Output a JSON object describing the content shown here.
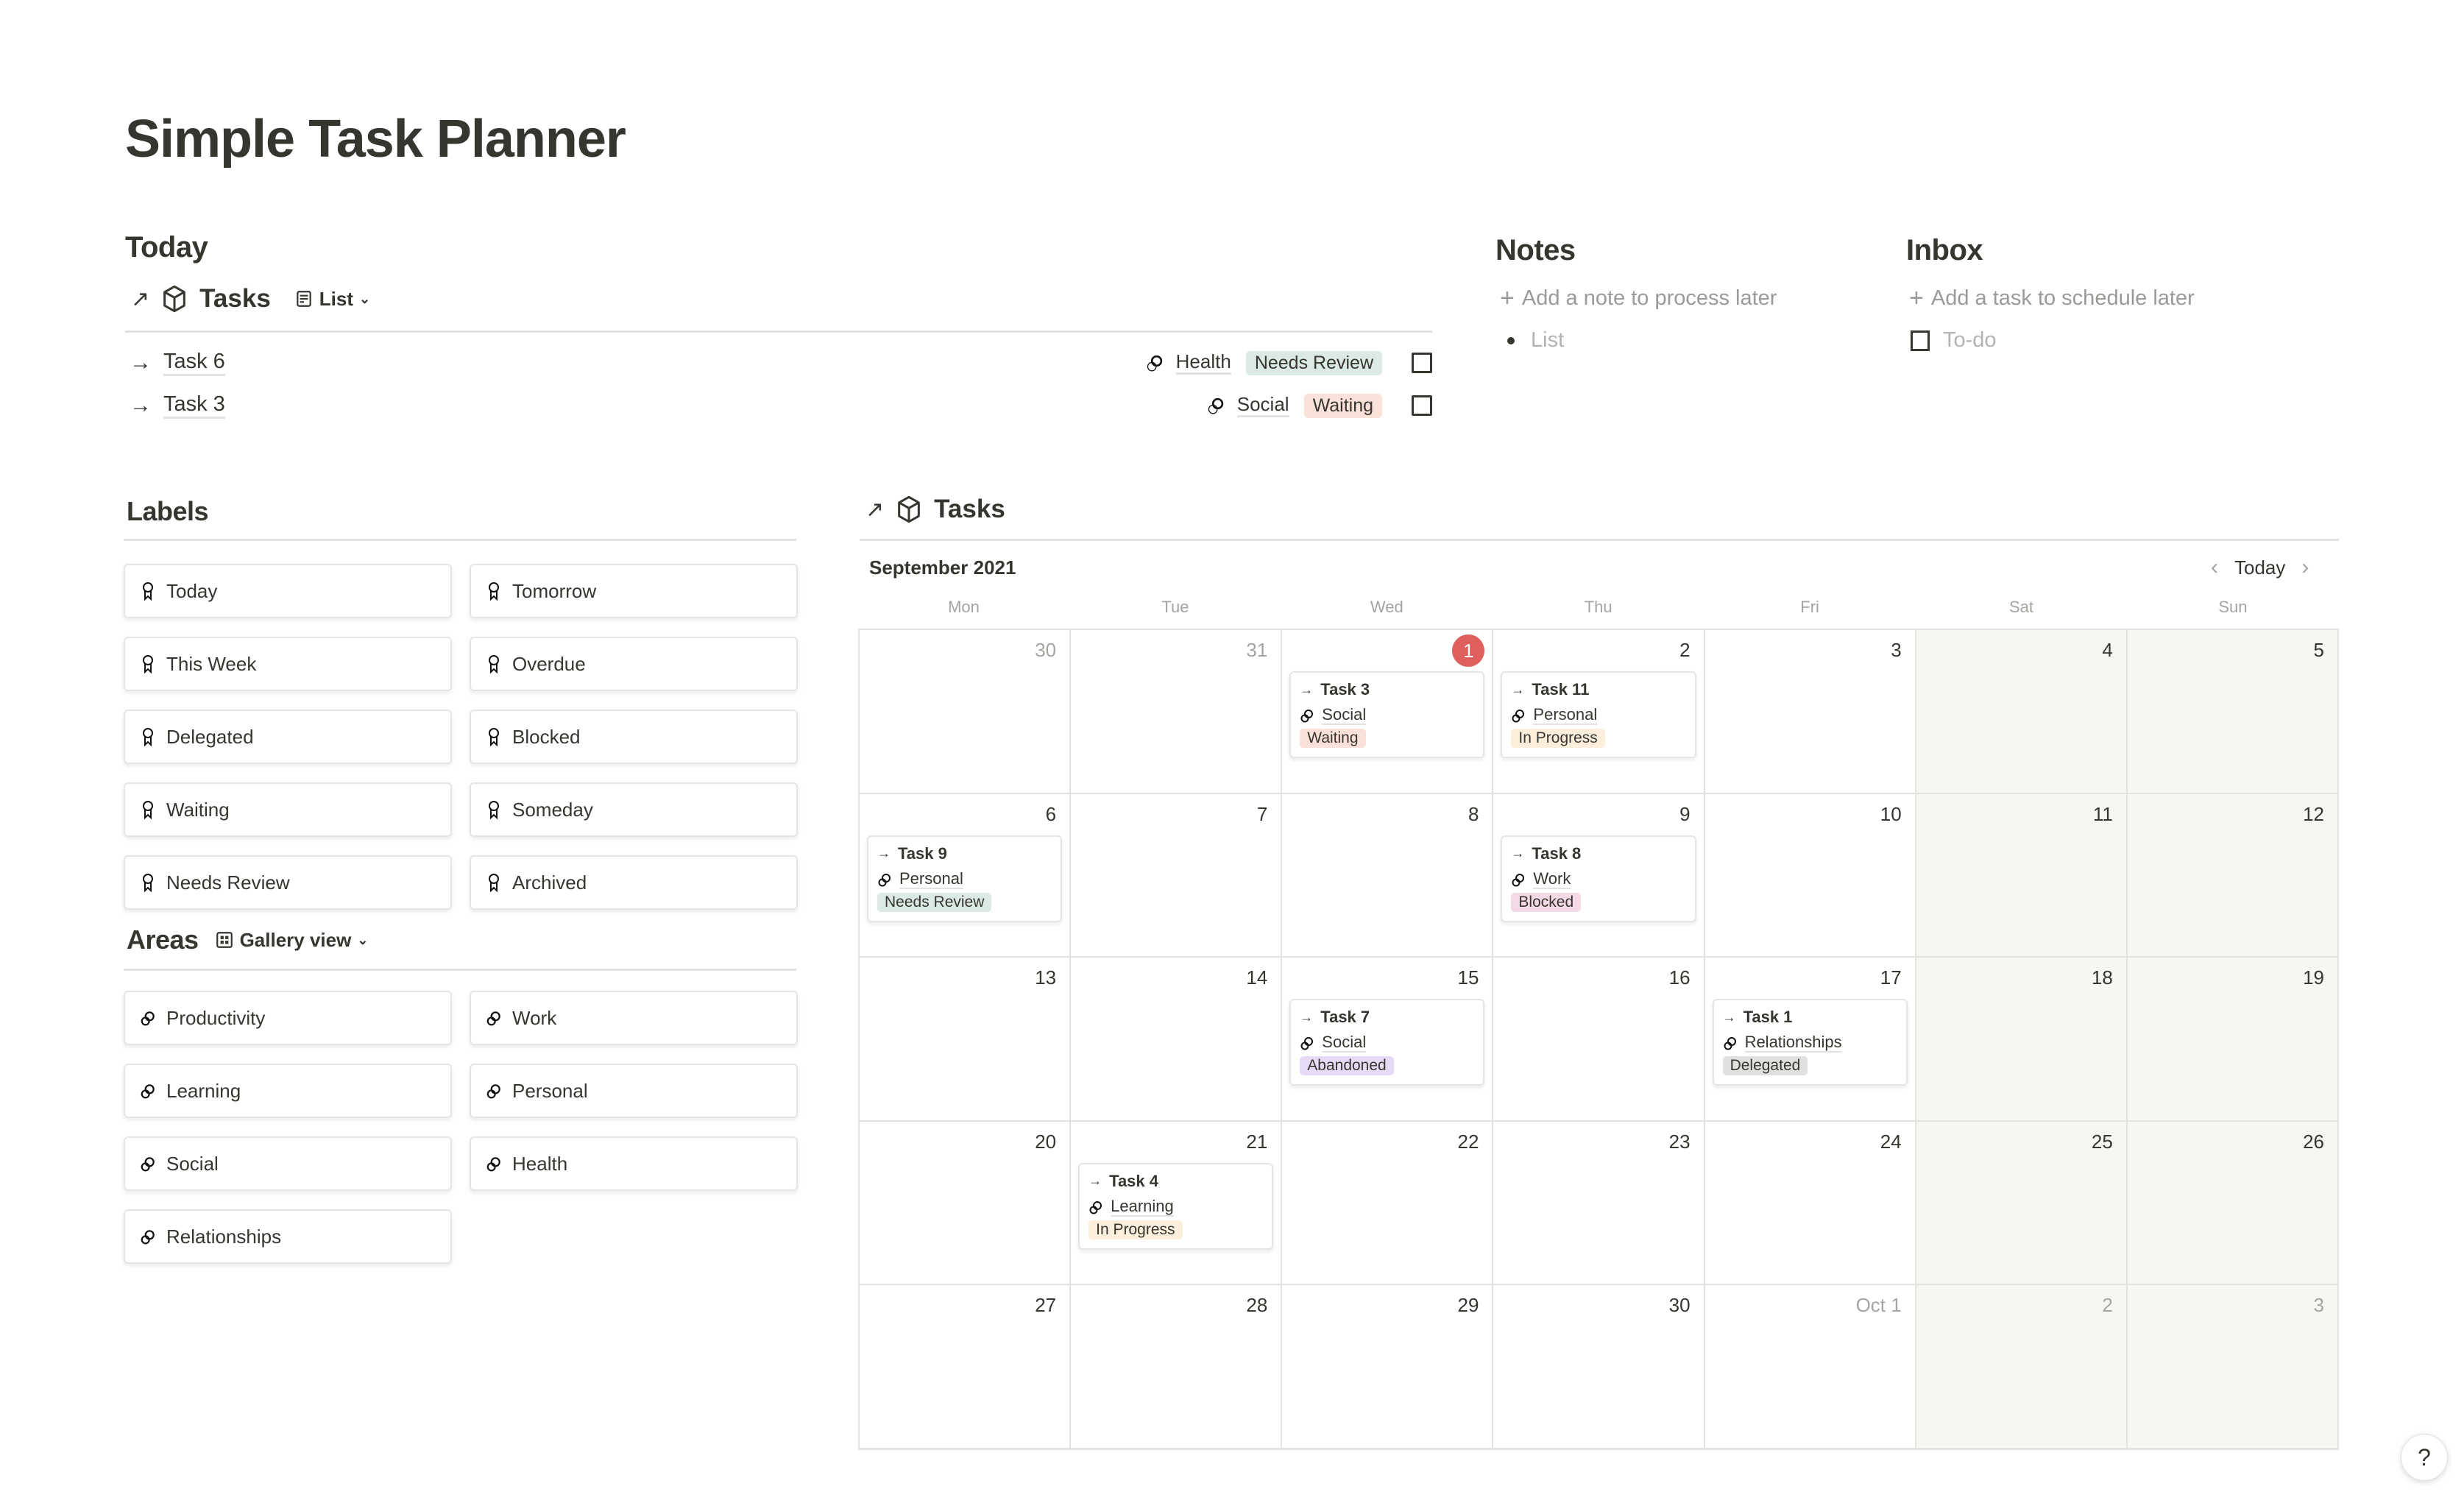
{
  "page": {
    "title": "Simple Task Planner"
  },
  "today": {
    "heading": "Today",
    "db_name": "Tasks",
    "view_label": "List",
    "rows": [
      {
        "name": "Task 6",
        "area": "Health",
        "status": "Needs Review",
        "status_color": "#dbeae5",
        "checked": false
      },
      {
        "name": "Task 3",
        "area": "Social",
        "status": "Waiting",
        "status_color": "#fbe2d8",
        "checked": false
      }
    ]
  },
  "notes": {
    "heading": "Notes",
    "add_label": "Add a note to process later",
    "list_placeholder": "List"
  },
  "inbox": {
    "heading": "Inbox",
    "add_label": "Add a task to schedule later",
    "todo_placeholder": "To-do"
  },
  "labels": {
    "heading": "Labels",
    "items": [
      "Today",
      "Tomorrow",
      "This Week",
      "Overdue",
      "Delegated",
      "Blocked",
      "Waiting",
      "Someday",
      "Needs Review",
      "Archived"
    ]
  },
  "areas": {
    "heading": "Areas",
    "view_label": "Gallery view",
    "items": [
      "Productivity",
      "Work",
      "Learning",
      "Personal",
      "Social",
      "Health",
      "Relationships"
    ]
  },
  "calendar": {
    "db_name": "Tasks",
    "month_label": "September 2021",
    "today_button": "Today",
    "weekdays": [
      "Mon",
      "Tue",
      "Wed",
      "Thu",
      "Fri",
      "Sat",
      "Sun"
    ],
    "days": [
      {
        "label": "30",
        "muted": true
      },
      {
        "label": "31",
        "muted": true
      },
      {
        "label": "1",
        "today": true
      },
      {
        "label": "2"
      },
      {
        "label": "3"
      },
      {
        "label": "4"
      },
      {
        "label": "5"
      },
      {
        "label": "6"
      },
      {
        "label": "7"
      },
      {
        "label": "8"
      },
      {
        "label": "9"
      },
      {
        "label": "10"
      },
      {
        "label": "11"
      },
      {
        "label": "12"
      },
      {
        "label": "13"
      },
      {
        "label": "14"
      },
      {
        "label": "15"
      },
      {
        "label": "16"
      },
      {
        "label": "17"
      },
      {
        "label": "18"
      },
      {
        "label": "19"
      },
      {
        "label": "20"
      },
      {
        "label": "21"
      },
      {
        "label": "22"
      },
      {
        "label": "23"
      },
      {
        "label": "24"
      },
      {
        "label": "25"
      },
      {
        "label": "26"
      },
      {
        "label": "27"
      },
      {
        "label": "28"
      },
      {
        "label": "29"
      },
      {
        "label": "30"
      },
      {
        "label": "Oct 1",
        "muted": true
      },
      {
        "label": "2",
        "muted": true
      },
      {
        "label": "3",
        "muted": true
      }
    ],
    "events": [
      {
        "day_index": 2,
        "name": "Task 3",
        "area": "Social",
        "status": "Waiting",
        "status_color": "#fbe2d8"
      },
      {
        "day_index": 3,
        "name": "Task 11",
        "area": "Personal",
        "status": "In Progress",
        "status_color": "#fbefdc"
      },
      {
        "day_index": 7,
        "name": "Task 9",
        "area": "Personal",
        "status": "Needs Review",
        "status_color": "#dbeae5"
      },
      {
        "day_index": 10,
        "name": "Task 8",
        "area": "Work",
        "status": "Blocked",
        "status_color": "#f6d9e6"
      },
      {
        "day_index": 16,
        "name": "Task 7",
        "area": "Social",
        "status": "Abandoned",
        "status_color": "#e6dbf6"
      },
      {
        "day_index": 18,
        "name": "Task 1",
        "area": "Relationships",
        "status": "Delegated",
        "status_color": "#e0e0de"
      },
      {
        "day_index": 22,
        "name": "Task 4",
        "area": "Learning",
        "status": "In Progress",
        "status_color": "#fbefdc"
      }
    ]
  },
  "help_button": "?"
}
